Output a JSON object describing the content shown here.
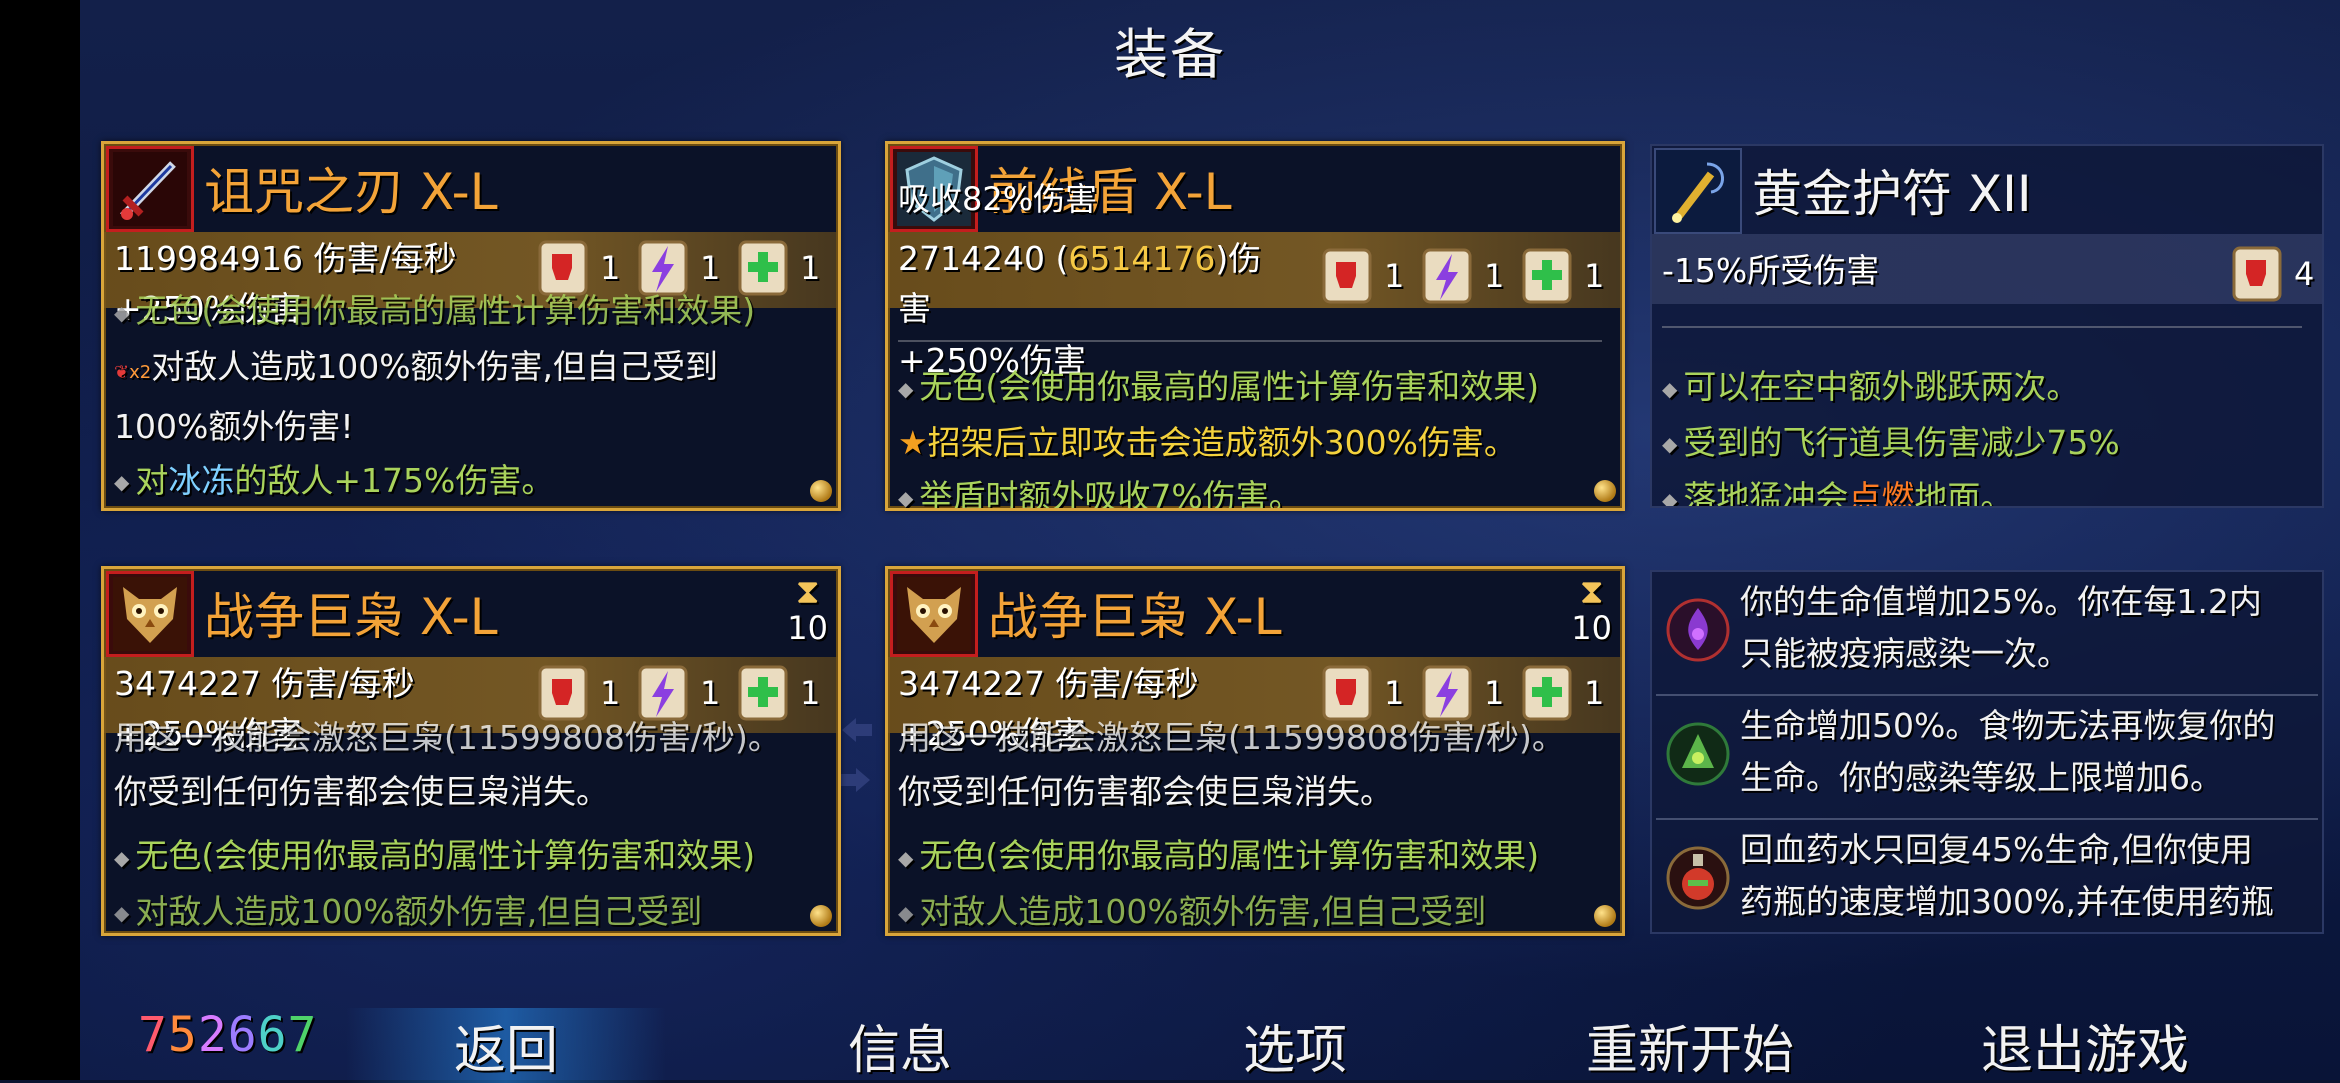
{
  "screen_title": "装备",
  "seed_digits": [
    "7",
    "5",
    "2",
    "6",
    "6",
    "7"
  ],
  "cards": {
    "weapon1": {
      "name": "诅咒之刃 X-L",
      "icon": "cursed-sword-icon",
      "dps": "119984916 伤害/每秒",
      "bonus": "+250%伤害",
      "scrolls": [
        "1",
        "1",
        "1"
      ],
      "desc_partial": "无色(会使用你最高的属性计算伤害和效果)",
      "curse_line_a": "对敌人造成100%额外伤害,但自己受到",
      "curse_line_b": "100%额外伤害!",
      "freeze_pre": "对",
      "freeze_word": "冰冻",
      "freeze_post": "的敌人+175%伤害。",
      "curse_badge": "x2"
    },
    "shield": {
      "name": "前线盾 X-L",
      "icon": "shield-icon",
      "tooltip": "吸收82%伤害",
      "stat_num": "2714240",
      "stat_open": " (",
      "stat_gold": "6514176",
      "stat_close": ")伤",
      "stat_cont": "害",
      "bonus": "+250%伤害",
      "scrolls": [
        "1",
        "1",
        "1"
      ],
      "desc1": "无色(会使用你最高的属性计算伤害和效果)",
      "parry_word": "招架",
      "parry_post": "后立即攻击会造成额外300%伤害。",
      "block": "举盾时额外吸收7%伤害。"
    },
    "amulet": {
      "name": "黄金护符 XII",
      "icon": "amulet-icon",
      "stat": "-15%所受伤害",
      "scroll_count": "4",
      "line1": "可以在空中额外跳跃两次。",
      "line2": "受到的飞行道具伤害减少75%",
      "line3_pre": "落地猛冲会",
      "line3_word": "点燃",
      "line3_post": "地面。"
    },
    "skill1": {
      "name": "战争巨枭 X-L",
      "icon": "war-owl-icon",
      "timer": "10",
      "dps": "3474227 伤害/每秒",
      "bonus": "+250%伤害",
      "scrolls": [
        "1",
        "1",
        "1"
      ],
      "cut_line": "用这一技能会激怒巨枭(11599808伤害/秒)。",
      "line2": "你受到任何伤害都会使巨枭消失。",
      "line3": "无色(会使用你最高的属性计算伤害和效果)",
      "line4": "对敌人造成100%额外伤害,但自己受到"
    },
    "skill2": {
      "name": "战争巨枭 X-L",
      "icon": "war-owl-icon",
      "timer": "10",
      "dps": "3474227 伤害/每秒",
      "bonus": "+250%伤害",
      "scrolls": [
        "1",
        "1",
        "1"
      ],
      "cut_line": "用这一技能会激怒巨枭(11599808伤害/秒)。",
      "line2": "你受到任何伤害都会使巨枭消失。",
      "line3": "无色(会使用你最高的属性计算伤害和效果)",
      "line4": "对敌人造成100%额外伤害,但自己受到"
    }
  },
  "mutations": [
    {
      "icon": "plague-mutation-icon",
      "line1": "你的生命值增加25%。你在每1.2内",
      "line2": "只能被疫病感染一次。"
    },
    {
      "icon": "disgusting-mutation-icon",
      "line1": "生命增加50%。食物无法再恢复你的",
      "line2": "生命。你的感染等级上限增加6。"
    },
    {
      "icon": "potion-mutation-icon",
      "line1": "回血药水只回复45%生命,但你使用",
      "line2": "药瓶的速度增加300%,并在使用药瓶"
    }
  ],
  "nav": {
    "back": "返回",
    "info": "信息",
    "options": "选项",
    "restart": "重新开始",
    "quit": "退出游戏"
  },
  "colors": {
    "gold_border": "#d9a53a",
    "title_orange": "#f3a338",
    "curse_red": "#c41e1e",
    "colorless_green": "#a9d35c",
    "keyword_yellow": "#f4d23d",
    "freeze_blue": "#7fd0ff",
    "burn_orange": "#ff7b22"
  }
}
